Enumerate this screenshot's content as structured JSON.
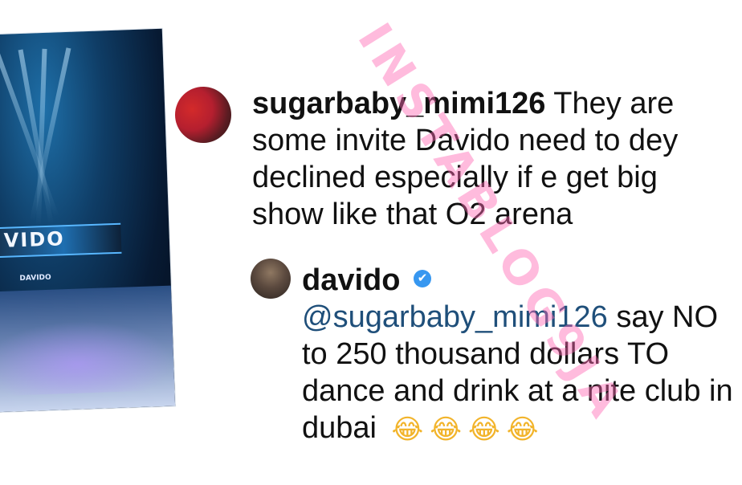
{
  "photo": {
    "banner_text": "VIDO",
    "small_tag": "DAVIDO"
  },
  "comments": [
    {
      "username": "sugarbaby_mimi126",
      "text": "They are some invite Davido need to dey declined especially if e get big show like that O2 arena"
    },
    {
      "username": "davido",
      "verified_icon": "✔",
      "mention": "@sugarbaby_mimi126",
      "text": "say NO to 250 thousand dollars TO dance and drink at a nite club in dubai",
      "emojis": [
        "😂",
        "😂",
        "😂",
        "😂"
      ]
    }
  ],
  "watermark": {
    "text": "INSTABLOG9JA"
  },
  "colors": {
    "mention": "#1f4f7a",
    "verified": "#3797f0",
    "watermark": "#ff69b4"
  }
}
